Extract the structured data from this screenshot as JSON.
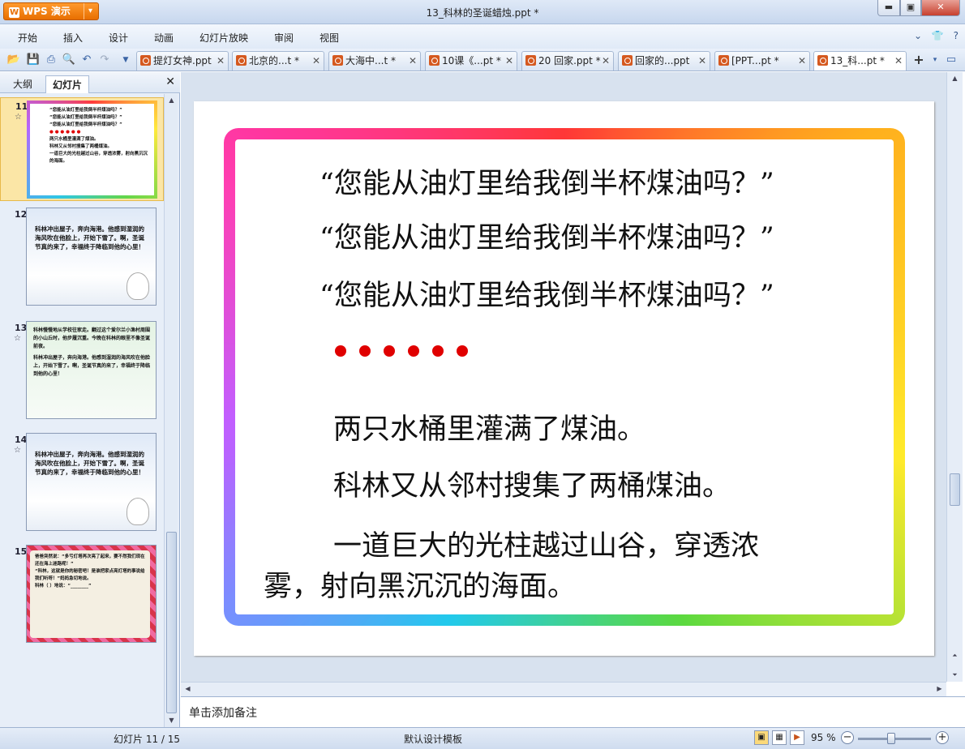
{
  "app": {
    "logo": "WPS 演示",
    "title": "13_科林的圣诞蜡烛.ppt *"
  },
  "window": {
    "minimize": "▬",
    "maximize": "▣",
    "close": "✕"
  },
  "menu": [
    "开始",
    "插入",
    "设计",
    "动画",
    "幻灯片放映",
    "审阅",
    "视图"
  ],
  "menu_right": [
    "⌄",
    "👕",
    "?"
  ],
  "doc_tabs": [
    {
      "label": "提灯女神.ppt"
    },
    {
      "label": "北京的...t *"
    },
    {
      "label": "大海中...t *"
    },
    {
      "label": "10课《...pt *"
    },
    {
      "label": "20 回家.ppt *"
    },
    {
      "label": "回家的...ppt"
    },
    {
      "label": "[PPT...pt *"
    },
    {
      "label": "13_科...pt *"
    }
  ],
  "panel": {
    "tabs": [
      "大纲",
      "幻灯片"
    ],
    "close": "✕"
  },
  "thumbnails": [
    {
      "num": "11",
      "lines": [
        "“您能从油灯里给我倒半杯煤油吗？”",
        "“您能从油灯里给我倒半杯煤油吗？”",
        "“您能从油灯里给我倒半杯煤油吗？”",
        "● ● ● ● ● ●",
        "两只水桶里灌满了煤油。",
        "科林又从邻村搜集了两桶煤油。",
        "一道巨大的光柱越过山谷，穿透浓雾，射向黑沉沉的海面。"
      ]
    },
    {
      "num": "12",
      "lines": [
        "科林冲出屋子，奔向海港。他感到湿润的海风吹在他脸上，开始下雪了。啊，圣诞节真的来了，幸福终于降临到他的心里！"
      ]
    },
    {
      "num": "13",
      "lines": [
        "科林慢慢地从学校往家走。翻过这个爱尔兰小渔村周围的小山丘时，他步履沉重。今晚在科林的眼里不像圣诞前夜。",
        "科林冲出屋子，奔向海港。他感到湿润的海风吹在他脸上，开始下雪了。啊，圣诞节真的来了，幸福终于降临到他的心里！"
      ]
    },
    {
      "num": "14",
      "lines": [
        "科林冲出屋子，奔向海港。他感到湿润的海风吹在他脸上，开始下雪了。啊，圣诞节真的来了，幸福终于降临到他的心里！"
      ]
    },
    {
      "num": "15",
      "lines": [
        "爸爸突然说：“多亏灯塔再次亮了起来，要不然我们现在还在海上迷路呢！”",
        "“科林，这就是你的秘密吧！是谁把家点亮灯塔的事说给我们听呀！”妈妈急切地说。",
        "科林（ ）地说：“________”"
      ]
    }
  ],
  "slide": {
    "quotes": [
      "“您能从油灯里给我倒半杯煤油吗？”",
      "“您能从油灯里给我倒半杯煤油吗？”",
      "“您能从油灯里给我倒半杯煤油吗？”"
    ],
    "line1": "两只水桶里灌满了煤油。",
    "line2": "科林又从邻村搜集了两桶煤油。",
    "line3a": "一道巨大的光柱越过山谷，穿透浓",
    "line3b": "雾，射向黑沉沉的海面。",
    "dot_color": "#e00000"
  },
  "notes": {
    "placeholder": "单击添加备注"
  },
  "status": {
    "slide": "幻灯片 11 / 15",
    "template": "默认设计模板",
    "zoom": "95 %",
    "zoom_minus": "−",
    "zoom_plus": "+"
  }
}
